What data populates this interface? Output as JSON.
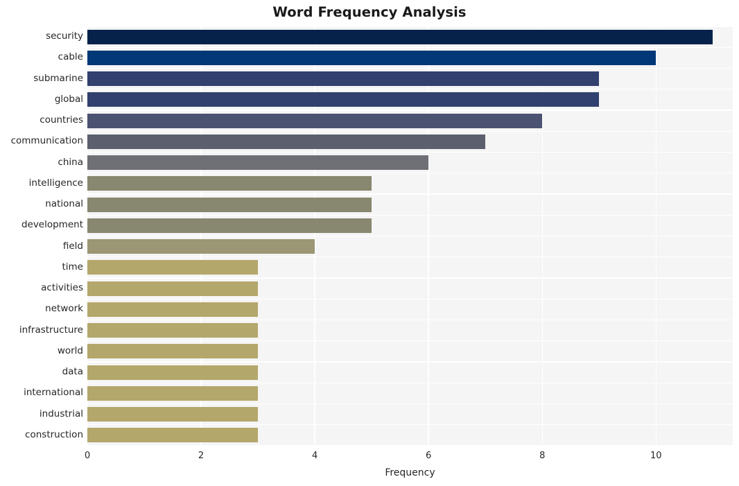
{
  "chart_data": {
    "type": "bar",
    "orientation": "horizontal",
    "title": "Word Frequency Analysis",
    "xlabel": "Frequency",
    "ylabel": "",
    "categories": [
      "security",
      "cable",
      "submarine",
      "global",
      "countries",
      "communication",
      "china",
      "intelligence",
      "national",
      "development",
      "field",
      "time",
      "activities",
      "network",
      "infrastructure",
      "world",
      "data",
      "international",
      "industrial",
      "construction"
    ],
    "values": [
      11,
      10,
      9,
      9,
      8,
      7,
      6,
      5,
      5,
      5,
      4,
      3,
      3,
      3,
      3,
      3,
      3,
      3,
      3,
      3
    ],
    "bar_colors": [
      "#06214a",
      "#023877",
      "#31406e",
      "#31406e",
      "#4c5271",
      "#5c5f6e",
      "#6e7076",
      "#88876f",
      "#88876f",
      "#88876f",
      "#9b9674",
      "#b3a76b",
      "#b3a76b",
      "#b3a76b",
      "#b3a76b",
      "#b3a76b",
      "#b3a76b",
      "#b3a76b",
      "#b3a76b",
      "#b3a76b"
    ],
    "xlim": [
      0,
      11.35
    ],
    "xticks": [
      0,
      2,
      4,
      6,
      8,
      10
    ],
    "xtick_labels": [
      "0",
      "2",
      "4",
      "6",
      "8",
      "10"
    ],
    "grid": true,
    "grid_color": "#ffffff",
    "plot_background": "#f5f5f5",
    "figure_background": "#ffffff",
    "legend": null
  }
}
